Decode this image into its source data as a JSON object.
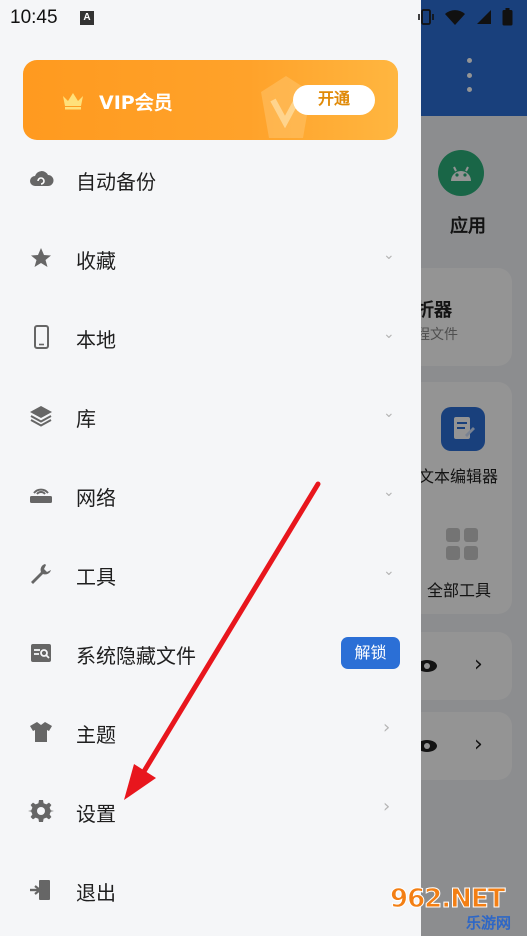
{
  "status_bar": {
    "time": "10:45",
    "notif_icon": "A"
  },
  "background": {
    "app_tile_label": "应用",
    "card_title_partial": "折器",
    "card_sub_partial": "程文件",
    "editor_label": "文本编辑器",
    "all_tools_label": "全部工具"
  },
  "drawer": {
    "vip": {
      "title": "VIP会员",
      "button": "开通"
    },
    "items": [
      {
        "label": "自动备份",
        "icon": "cloud-backup-icon",
        "chevron": ""
      },
      {
        "label": "收藏",
        "icon": "star-icon",
        "chevron": "⌄"
      },
      {
        "label": "本地",
        "icon": "phone-icon",
        "chevron": "⌄"
      },
      {
        "label": "库",
        "icon": "layers-icon",
        "chevron": "⌄"
      },
      {
        "label": "网络",
        "icon": "router-icon",
        "chevron": "⌄"
      },
      {
        "label": "工具",
        "icon": "wrench-icon",
        "chevron": "⌄"
      },
      {
        "label": "系统隐藏文件",
        "icon": "hidden-files-icon",
        "badge": "解锁"
      },
      {
        "label": "主题",
        "icon": "tshirt-icon",
        "chevron": "›"
      },
      {
        "label": "设置",
        "icon": "gear-icon",
        "chevron": "›"
      },
      {
        "label": "退出",
        "icon": "exit-icon",
        "chevron": ""
      }
    ]
  },
  "watermark": {
    "top": "962.NET",
    "bottom": "乐游网"
  },
  "colors": {
    "accent": "#2b6fd6",
    "vip_orange": "#ff9a1f",
    "arrow": "#e8161d"
  }
}
